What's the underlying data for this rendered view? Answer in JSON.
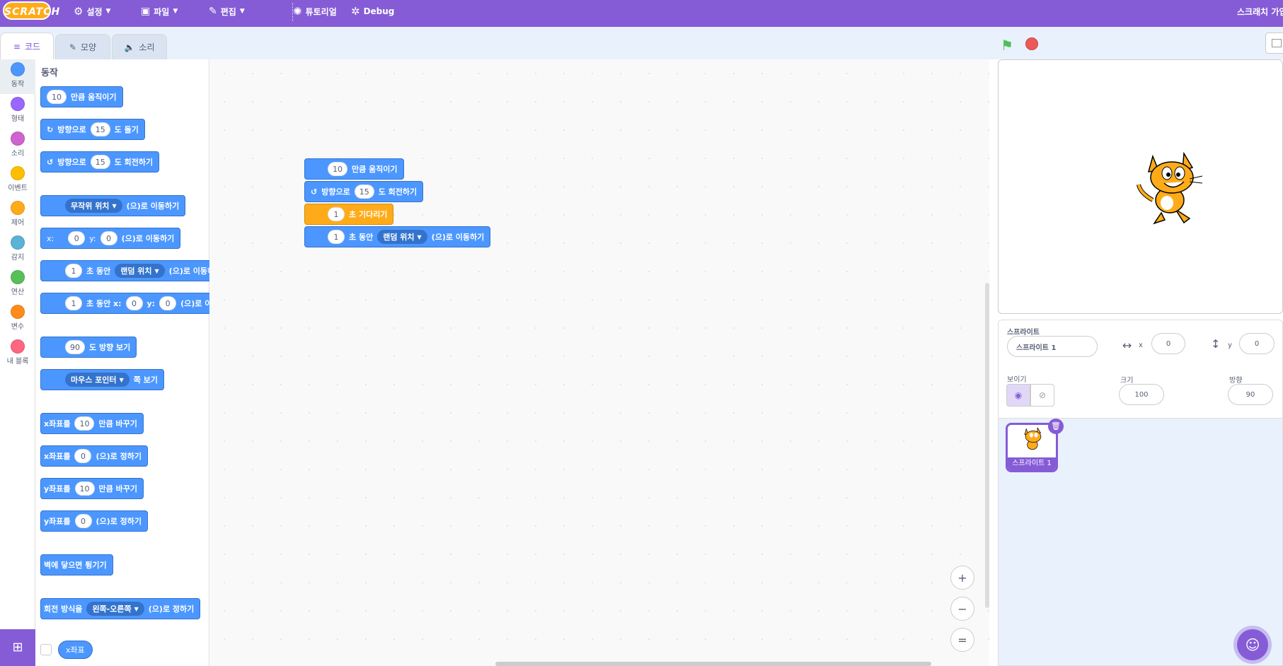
{
  "menubar": {
    "logo": "SCRATCH",
    "settings": "설정",
    "file": "파일",
    "edit": "편집",
    "tutorials": "튜토리얼",
    "debug": "Debug",
    "right_text": "스크래치 가입"
  },
  "tabs": {
    "code": "코드",
    "costumes": "모양",
    "sounds": "소리"
  },
  "categories": [
    {
      "label": "동작",
      "color": "#4c97ff"
    },
    {
      "label": "형태",
      "color": "#9966ff"
    },
    {
      "label": "소리",
      "color": "#cf63cf"
    },
    {
      "label": "이벤트",
      "color": "#ffbf00"
    },
    {
      "label": "제어",
      "color": "#ffab19"
    },
    {
      "label": "감지",
      "color": "#5cb1d6"
    },
    {
      "label": "연산",
      "color": "#59c059"
    },
    {
      "label": "변수",
      "color": "#ff8c1a"
    },
    {
      "label": "내 블록",
      "color": "#ff6680"
    }
  ],
  "flyout": {
    "title": "동작",
    "move": {
      "value": "10",
      "text": "만큼 움직이기"
    },
    "turn_right": {
      "pre": "방향으로",
      "value": "15",
      "post": "도 돌기"
    },
    "turn_left": {
      "pre": "방향으로",
      "value": "15",
      "post": "도 회전하기"
    },
    "goto": {
      "dropdown": "무작위 위치",
      "post": "(으)로 이동하기"
    },
    "goto_xy": {
      "x_label": "x:",
      "x": "0",
      "y_label": "y:",
      "y": "0",
      "post": "(으)로 이동하기"
    },
    "glide": {
      "value": "1",
      "mid": "초 동안",
      "dropdown": "랜덤 위치",
      "post": "(으)로 이동하기"
    },
    "glide_xy": {
      "value": "1",
      "mid": "초 동안 x:",
      "x": "0",
      "y_label": "y:",
      "y": "0",
      "post": "(으)로 이동하기"
    },
    "point_dir": {
      "value": "90",
      "post": "도 방향 보기"
    },
    "point_towards": {
      "dropdown": "마우스 포인터",
      "post": "쪽 보기"
    },
    "change_x": {
      "pre": "x좌표를",
      "value": "10",
      "post": "만큼 바꾸기"
    },
    "set_x": {
      "pre": "x좌표를",
      "value": "0",
      "post": "(으)로 정하기"
    },
    "change_y": {
      "pre": "y좌표를",
      "value": "10",
      "post": "만큼 바꾸기"
    },
    "set_y": {
      "pre": "y좌표를",
      "value": "0",
      "post": "(으)로 정하기"
    },
    "bounce": "벽에 닿으면 튕기기",
    "rotation": {
      "pre": "회전 방식을",
      "dropdown": "왼쪽-오른쪽",
      "post": "(으)로 정하기"
    },
    "xpos": "x좌표"
  },
  "script": {
    "move": {
      "value": "10",
      "text": "만큼 움직이기"
    },
    "turn": {
      "pre": "방향으로",
      "value": "15",
      "post": "도 회전하기"
    },
    "wait": {
      "value": "1",
      "text": "초 기다리기"
    },
    "glide": {
      "value": "1",
      "mid": "초 동안",
      "dropdown": "랜덤 위치",
      "post": "(으)로 이동하기"
    }
  },
  "zoom": {
    "in": "+",
    "out": "−",
    "reset": "="
  },
  "sprite_panel": {
    "sprite_label": "스프라이트",
    "sprite_name": "스프라이트 1",
    "x_label": "x",
    "x": "0",
    "y_label": "y",
    "y": "0",
    "show_label": "보이기",
    "size_label": "크기",
    "size": "100",
    "direction_label": "방향",
    "direction": "90"
  },
  "sprite_list": [
    {
      "name": "스프라이트 1"
    }
  ]
}
